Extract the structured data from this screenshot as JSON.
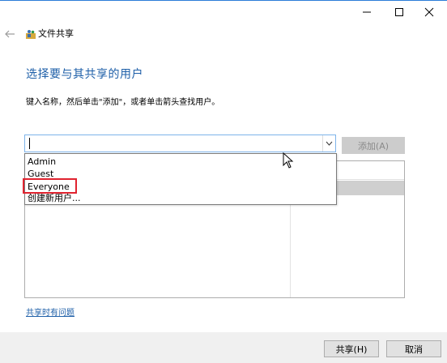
{
  "window": {
    "title": "文件共享",
    "minimize_glyph": "—",
    "maximize_glyph": "☐",
    "close_glyph": "✕",
    "accent_color": "#2b7dd8"
  },
  "main": {
    "heading": "选择要与其共享的用户",
    "instruction": "键入名称，然后单击\"添加\"，或者单击箭头查找用户。",
    "combo_value": "",
    "add_button": "添加(A)",
    "dropdown_options": [
      "Admin",
      "Guest",
      "Everyone",
      "创建新用户..."
    ],
    "highlighted_option": "Everyone",
    "help_link": "共享时有问题"
  },
  "footer": {
    "share_button": "共享(H)",
    "cancel_button": "取消"
  },
  "icons": {
    "back": "back-arrow-icon",
    "app": "file-sharing-icon",
    "dropdown": "chevron-down-icon",
    "cursor": "mouse-pointer-icon"
  },
  "colors": {
    "heading": "#1e5fa8",
    "highlight_border": "#e0232f",
    "combo_border": "#7eb4ea"
  }
}
